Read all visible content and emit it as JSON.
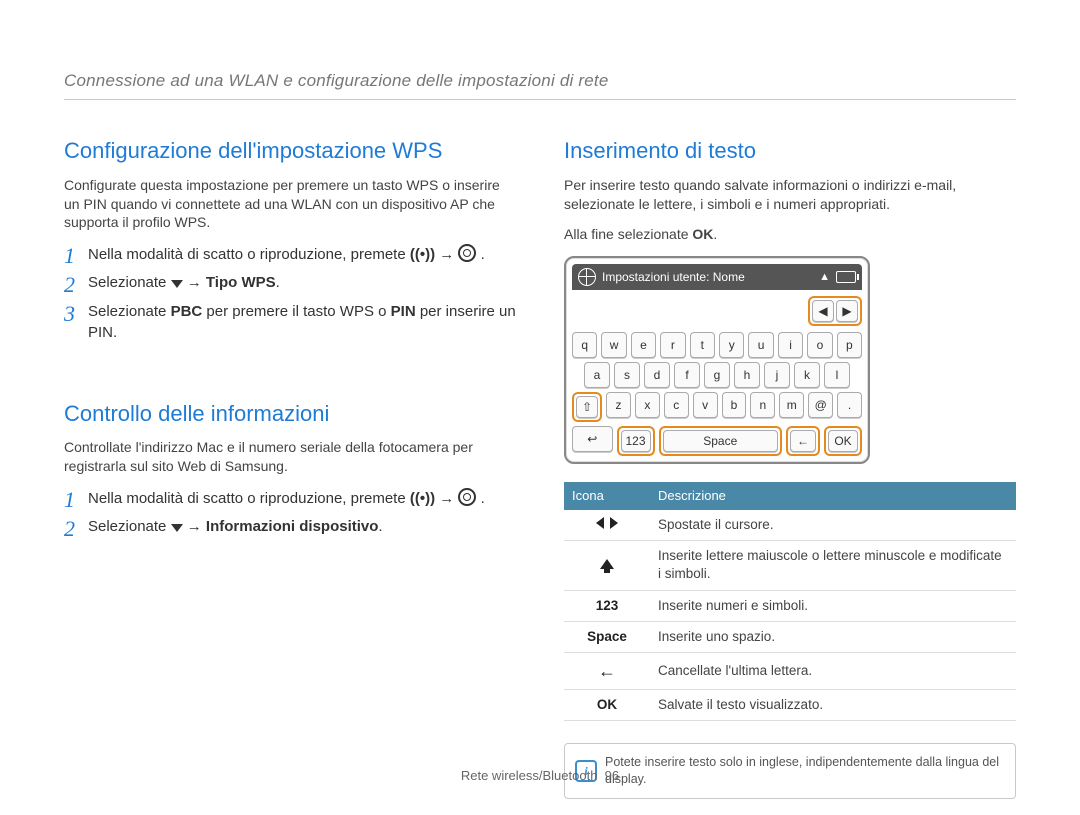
{
  "breadcrumb": "Connessione ad una WLAN e configurazione delle impostazioni di rete",
  "left": {
    "section1": {
      "title": "Configurazione dell'impostazione WPS",
      "body": "Configurate questa impostazione per premere un tasto WPS o inserire un PIN quando vi connettete ad una WLAN con un dispositivo AP che supporta il profilo WPS.",
      "step1": "Nella modalità di scatto o riproduzione, premete ",
      "step1_tail": ".",
      "step2_a": "Selezionate ",
      "step2_b": " → ",
      "step2_bold": "Tipo WPS",
      "step2_c": ".",
      "step3_a": "Selezionate ",
      "step3_bold1": "PBC",
      "step3_b": " per premere il tasto WPS o ",
      "step3_bold2": "PIN",
      "step3_c": " per inserire un PIN."
    },
    "section2": {
      "title": "Controllo delle informazioni",
      "body": "Controllate l'indirizzo Mac e il numero seriale della fotocamera per registrarla sul sito Web di Samsung.",
      "step1": "Nella modalità di scatto o riproduzione, premete ",
      "step1_tail": ".",
      "step2_a": "Selezionate ",
      "step2_b": " → ",
      "step2_bold": "Informazioni dispositivo",
      "step2_c": "."
    }
  },
  "right": {
    "title": "Inserimento di testo",
    "body": "Per inserire testo quando salvate informazioni o indirizzi e-mail, selezionate le lettere, i simboli e i numeri appropriati.",
    "finish_a": "Alla fine selezionate ",
    "finish_bold": "OK",
    "finish_b": ".",
    "kb": {
      "title": "Impostazioni utente: Nome",
      "row1": [
        "q",
        "w",
        "e",
        "r",
        "t",
        "y",
        "u",
        "i",
        "o",
        "p"
      ],
      "row2": [
        "a",
        "s",
        "d",
        "f",
        "g",
        "h",
        "j",
        "k",
        "l"
      ],
      "row3_shift": "⇧",
      "row3": [
        "z",
        "x",
        "c",
        "v",
        "b",
        "n",
        "m",
        "@",
        "."
      ],
      "row4_back": "↩",
      "row4_123": "123",
      "row4_space": "Space",
      "row4_bksp": "←",
      "row4_ok": "OK"
    },
    "legend": {
      "h1": "Icona",
      "h2": "Descrizione",
      "rows": [
        {
          "icon": "lr",
          "text": "Spostate il cursore."
        },
        {
          "icon": "up",
          "text": "Inserite lettere maiuscole o lettere minuscole e modificate i simboli."
        },
        {
          "icon": "123",
          "text": "Inserite numeri e simboli."
        },
        {
          "icon": "Space",
          "text": "Inserite uno spazio."
        },
        {
          "icon": "bksp",
          "text": "Cancellate l'ultima lettera."
        },
        {
          "icon": "OK",
          "text": "Salvate il testo visualizzato."
        }
      ]
    },
    "note": "Potete inserire testo solo in inglese, indipendentemente dalla lingua del display."
  },
  "footer": {
    "text": "Rete wireless/Bluetooth",
    "page": "96"
  }
}
